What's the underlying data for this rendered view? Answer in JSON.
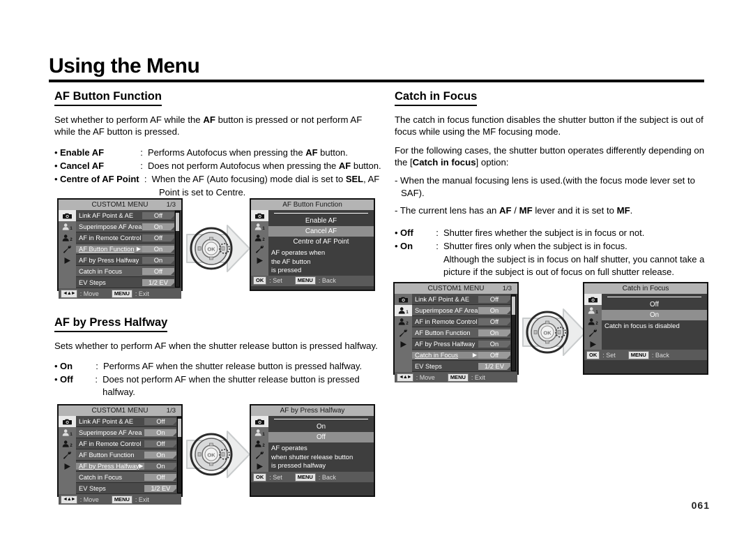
{
  "page": {
    "title": "Using the Menu",
    "page_number": "061"
  },
  "sections": {
    "af_button_function": {
      "heading": "AF Button Function",
      "intro": "Set whether to perform AF while the AF button is pressed or not perform AF while the AF button is pressed.",
      "bullets": [
        {
          "term": "Enable AF",
          "colon": ":",
          "desc": "Performs Autofocus when pressing the AF button."
        },
        {
          "term": "Cancel AF",
          "colon": ":",
          "desc": "Does not perform Autofocus when pressing the AF button."
        },
        {
          "term": "Centre of AF Point",
          "colon": ":",
          "desc": "When the AF (Auto focusing) mode dial is set to SEL, AF"
        }
      ],
      "bullet_continuation": "Point is set to Centre."
    },
    "af_by_press_halfway": {
      "heading": "AF by Press Halfway",
      "intro": "Sets whether to perform AF when the shutter release button is pressed halfway.",
      "bullets": [
        {
          "term": "On",
          "colon": ":",
          "desc": "Performs AF when the shutter release button is pressed halfway."
        },
        {
          "term": "Off",
          "colon": ":",
          "desc": "Does not perform AF when the shutter release button is pressed halfway."
        }
      ]
    },
    "catch_in_focus": {
      "heading": "Catch in Focus",
      "intro": "The catch in focus function disables the shutter button if the subject is out of focus while using the MF focusing mode.",
      "intro2": "For the following cases, the shutter button operates differently depending on the [Catch in focus] option:",
      "dash_items": [
        "- When the manual focusing lens is used.(with the focus mode lever set to SAF).",
        "- The current lens has an AF / MF lever and it is set to MF."
      ],
      "bullets": [
        {
          "term": "Off",
          "colon": ":",
          "desc": "Shutter fires whether the subject is in focus or not."
        },
        {
          "term": "On",
          "colon": ":",
          "desc": "Shutter fires only when the subject is in focus."
        }
      ],
      "bullet_continuation": "Although the subject is in focus on half shutter, you cannot take a picture if the subject is out of focus on full shutter release."
    }
  },
  "menu_screens": {
    "custom1_common": {
      "header_title": "CUSTOM1 MENU",
      "header_page": "1/3",
      "rows": [
        {
          "label": "Link AF Point & AE",
          "value": "Off"
        },
        {
          "label": "Superimpose AF Area",
          "value": "On"
        },
        {
          "label": "AF in Remote Control",
          "value": "Off"
        },
        {
          "label": "AF Button Function",
          "value": "On"
        },
        {
          "label": "AF by Press Halfway",
          "value": "On"
        },
        {
          "label": "Catch in Focus",
          "value": "Off"
        },
        {
          "label": "EV Steps",
          "value": "1/2 EV"
        }
      ],
      "footer_move_key": "◄▲►",
      "footer_move_label": ": Move",
      "footer_menu_key": "MENU",
      "footer_menu_label": ": Exit"
    },
    "detail_common": {
      "footer_ok_key": "OK",
      "footer_ok_label": ": Set",
      "footer_menu_key": "MENU",
      "footer_menu_label": ": Back"
    },
    "screen_af_button_function": {
      "title": "AF Button Function",
      "options": [
        "Enable AF",
        "Cancel AF",
        "Centre of AF Point"
      ],
      "selected": "Cancel AF",
      "description": "AF operates when\nthe AF button\nis pressed"
    },
    "screen_af_by_press_halfway": {
      "title": "AF by Press Halfway",
      "options": [
        "On",
        "Off"
      ],
      "selected": "Off",
      "description": "AF operates\nwhen shutter release button\nis pressed halfway"
    },
    "screen_catch_in_focus": {
      "title": "Catch in Focus",
      "options": [
        "Off",
        "On"
      ],
      "selected": "On",
      "description": "Catch in focus is disabled"
    }
  },
  "sidebar_icons": [
    "camera-icon",
    "person-1-icon",
    "person-2-icon",
    "wrench-icon",
    "playback-icon"
  ],
  "dial": {
    "center_label": "OK",
    "name": "four-way-navigation-dial"
  },
  "colors": {
    "lcd_background": "#3a3a3a",
    "lcd_header": "#b4b4b4",
    "row_odd": "#4a4a4a",
    "row_even": "#5d5d5d",
    "selected": "#8f8f8f",
    "sidebar": "#6e6e6e",
    "text": "#ffffff"
  }
}
